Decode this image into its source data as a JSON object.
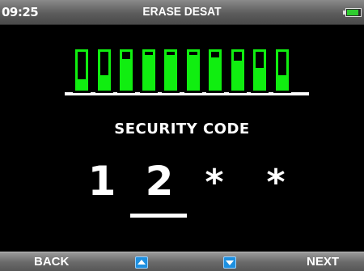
{
  "status_bar": {
    "time": "09:25",
    "title": "ERASE DESAT",
    "battery_level": 0.85,
    "battery_color": "#2fcc2f"
  },
  "gauge": {
    "bar_color": "#10ee10",
    "bars": [
      {
        "fill": 0.25
      },
      {
        "fill": 0.35
      },
      {
        "fill": 0.8
      },
      {
        "fill": 0.92
      },
      {
        "fill": 0.92
      },
      {
        "fill": 0.92
      },
      {
        "fill": 0.85
      },
      {
        "fill": 0.75
      },
      {
        "fill": 0.55
      },
      {
        "fill": 0.35
      }
    ]
  },
  "security": {
    "label": "SECURITY CODE",
    "digits": [
      "1",
      "2",
      "*",
      "*"
    ],
    "active_index": 1
  },
  "softkeys": {
    "back_label": "BACK",
    "up_icon": "up-arrow-icon",
    "down_icon": "down-arrow-icon",
    "next_label": "NEXT",
    "arrow_color": "#1e90e0"
  }
}
